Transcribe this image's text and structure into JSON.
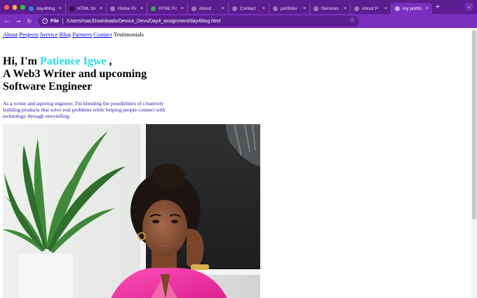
{
  "browser": {
    "tabs": [
      {
        "title": "day4blog",
        "favicon": "vscode-icon",
        "fav_color": "#2f80ed",
        "active": false
      },
      {
        "title": "HTML for",
        "favicon": "dark-circle-icon",
        "fav_color": "#2b1540",
        "active": false
      },
      {
        "title": "Home Pa",
        "favicon": "globe-icon",
        "fav_color": "#9c7ab9",
        "active": false
      },
      {
        "title": "HTML Fo",
        "favicon": "w-icon",
        "fav_color": "#3aa856",
        "active": false
      },
      {
        "title": "About",
        "favicon": "globe-icon",
        "fav_color": "#9c7ab9",
        "active": false
      },
      {
        "title": "Contact",
        "favicon": "globe-icon",
        "fav_color": "#9c7ab9",
        "active": false
      },
      {
        "title": "portfolio",
        "favicon": "globe-icon",
        "fav_color": "#9c7ab9",
        "active": false
      },
      {
        "title": "Services",
        "favicon": "globe-icon",
        "fav_color": "#9c7ab9",
        "active": false
      },
      {
        "title": "About P",
        "favicon": "globe-icon",
        "fav_color": "#9c7ab9",
        "active": false
      },
      {
        "title": "my portfo",
        "favicon": "globe-icon",
        "fav_color": "#c7a9e6",
        "active": true
      }
    ],
    "close_glyph": "×",
    "new_tab_glyph": "+",
    "tab_menu_glyph": "⌄",
    "back_glyph": "←",
    "forward_glyph": "→",
    "reload_glyph": "↻",
    "info_glyph": "i",
    "scheme": "File",
    "url": "/Users/mac/Downloads/Devout_Devs/Day4_assignment/day4blog.html",
    "bookmark_glyph": "☆",
    "menu_glyph": "⋮",
    "colors": {
      "tabstrip": "#5b1d8f",
      "toolbar": "#7b2fbe"
    }
  },
  "site": {
    "nav": [
      {
        "label": "About",
        "link": true
      },
      {
        "label": "Projects",
        "link": true
      },
      {
        "label": "Service",
        "link": true
      },
      {
        "label": "Blog",
        "link": true
      },
      {
        "label": "Partners",
        "link": true
      },
      {
        "label": "Contact",
        "link": true
      },
      {
        "label": "Testimonials",
        "link": false
      }
    ],
    "hero": {
      "greeting": "Hi, I'm ",
      "name": "Patience Igwe",
      "comma": " ,",
      "line2": "A Web3 Writer and upcoming",
      "line3": "Software Engineer"
    },
    "intro": "As a writer and aspiring engineer, I'm blending the possibilities of creatively building products that solve real problems while helping people connect with technology through storytelling.",
    "colors": {
      "name_highlight": "#1fe0e6",
      "intro_text": "#2a0fa8",
      "link": "#0000ee"
    }
  }
}
